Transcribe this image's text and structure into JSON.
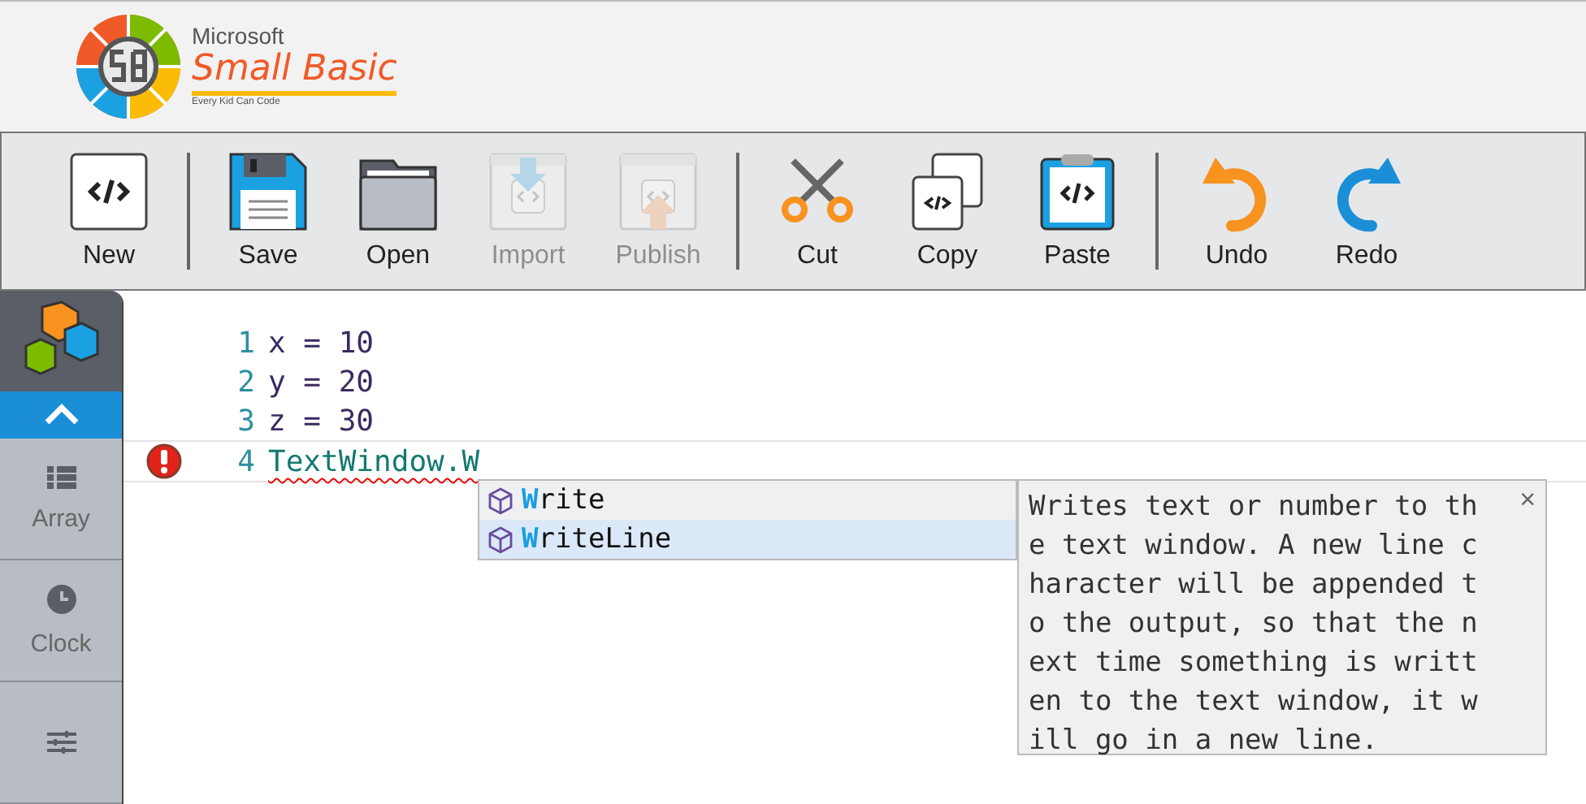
{
  "logo": {
    "brand": "Microsoft",
    "product": "Small Basic",
    "tagline": "Every Kid Can Code"
  },
  "toolbar": [
    {
      "kind": "new",
      "label": "New",
      "disabled": false,
      "separator_before": false
    },
    {
      "kind": "save",
      "label": "Save",
      "disabled": false,
      "separator_before": true
    },
    {
      "kind": "open",
      "label": "Open",
      "disabled": false,
      "separator_before": false
    },
    {
      "kind": "import",
      "label": "Import",
      "disabled": true,
      "separator_before": false
    },
    {
      "kind": "publish",
      "label": "Publish",
      "disabled": true,
      "separator_before": false
    },
    {
      "kind": "cut",
      "label": "Cut",
      "disabled": false,
      "separator_before": true
    },
    {
      "kind": "copy",
      "label": "Copy",
      "disabled": false,
      "separator_before": false
    },
    {
      "kind": "paste",
      "label": "Paste",
      "disabled": false,
      "separator_before": false
    },
    {
      "kind": "undo",
      "label": "Undo",
      "disabled": false,
      "separator_before": true
    },
    {
      "kind": "redo",
      "label": "Redo",
      "disabled": false,
      "separator_before": false
    }
  ],
  "sidebar": {
    "items": [
      {
        "kind": "array",
        "label": "Array"
      },
      {
        "kind": "clock",
        "label": "Clock"
      },
      {
        "kind": "control"
      }
    ]
  },
  "editor": {
    "lines": [
      {
        "number": "1",
        "code": "x = 10",
        "error": false
      },
      {
        "number": "2",
        "code": "y = 20",
        "error": false
      },
      {
        "number": "3",
        "code": "z = 30",
        "error": false
      },
      {
        "number": "4",
        "code": "TextWindow.W",
        "error": true
      }
    ]
  },
  "autocomplete": {
    "items": [
      {
        "match": "W",
        "rest": "rite",
        "selected": false
      },
      {
        "match": "W",
        "rest": "riteLine",
        "selected": true
      }
    ]
  },
  "tooltip": {
    "text": "Writes text or number to the text window. A new line character will be appended to the output, so that the next time something is written to the text window, it will go in a new line.",
    "close": "×"
  }
}
